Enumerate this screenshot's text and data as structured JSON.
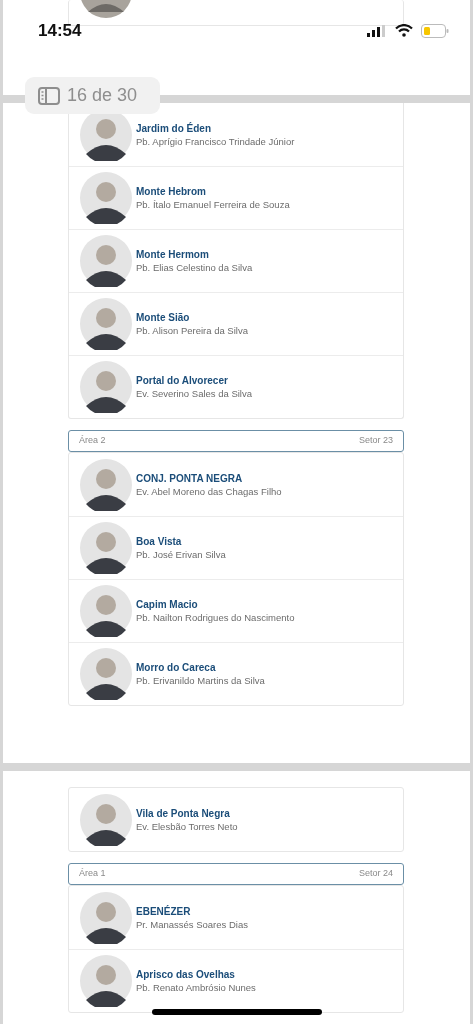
{
  "status_bar": {
    "time": "14:54"
  },
  "page_indicator": {
    "text": "16 de 30"
  },
  "pages": [
    {
      "groups": [
        {
          "entries": [
            {
              "church": "Jardim do Éden",
              "pastor": "Pb. Aprígio Francisco Trindade Júnior"
            },
            {
              "church": "Monte Hebrom",
              "pastor": "Pb. Ítalo Emanuel Ferreira de Souza"
            },
            {
              "church": "Monte Hermom",
              "pastor": "Pb. Elias Celestino da Silva"
            },
            {
              "church": "Monte Sião",
              "pastor": "Pb. Alison Pereira da Silva"
            },
            {
              "church": "Portal do Alvorecer",
              "pastor": "Ev. Severino Sales da Silva"
            }
          ]
        },
        {
          "header": {
            "area": "Área 2",
            "sector": "Setor 23"
          },
          "entries": [
            {
              "church": "CONJ. PONTA NEGRA",
              "pastor": "Ev. Abel Moreno das Chagas Filho"
            },
            {
              "church": "Boa Vista",
              "pastor": "Pb. José Erivan Silva"
            },
            {
              "church": "Capim Macio",
              "pastor": "Pb. Nailton Rodrigues do Nascimento"
            },
            {
              "church": "Morro do Careca",
              "pastor": "Pb. Erivanildo Martins da Silva"
            }
          ]
        }
      ]
    },
    {
      "groups": [
        {
          "entries": [
            {
              "church": "Vila de Ponta Negra",
              "pastor": "Ev. Elesbão Torres Neto"
            }
          ]
        },
        {
          "header": {
            "area": "Área 1",
            "sector": "Setor 24"
          },
          "entries": [
            {
              "church": "EBENÉZER",
              "pastor": "Pr. Manassés Soares Dias"
            },
            {
              "church": "Aprisco das Ovelhas",
              "pastor": "Pb. Renato Ambrósio Nunes"
            }
          ]
        }
      ]
    }
  ]
}
